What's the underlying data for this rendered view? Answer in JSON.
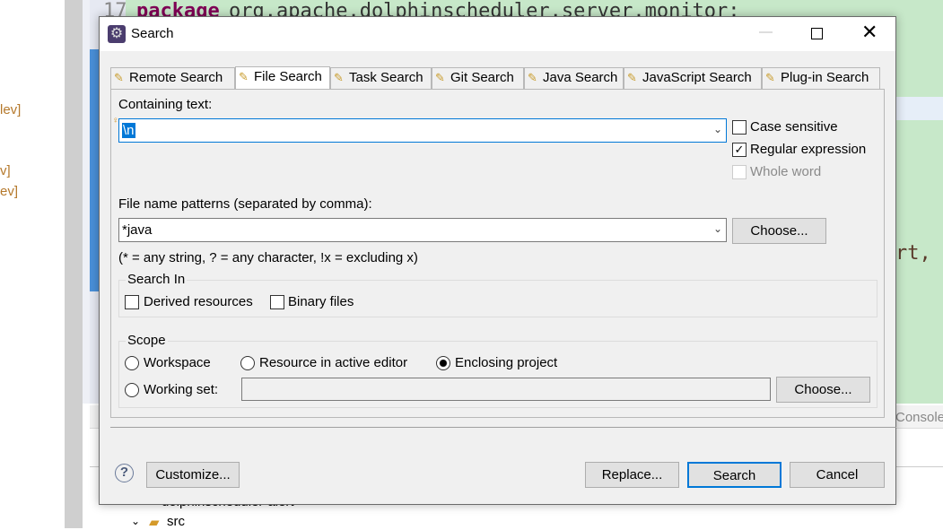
{
  "background": {
    "left_labels": [
      "lev]",
      "v]",
      "ev]"
    ],
    "code_line_number": "17",
    "code_keyword": "package",
    "code_text": " org.apache.dolphinscheduler.server.monitor;",
    "code_fragment": "rt, ",
    "console_tab": "Console",
    "tree_project": "dolphinscheduler-alert",
    "tree_src": "src"
  },
  "dialog": {
    "title": "Search",
    "tabs": [
      {
        "label": "Remote Search",
        "active": false
      },
      {
        "label": "File Search",
        "active": true
      },
      {
        "label": "Task Search",
        "active": false
      },
      {
        "label": "Git Search",
        "active": false
      },
      {
        "label": "Java Search",
        "active": false
      },
      {
        "label": "JavaScript Search",
        "active": false
      },
      {
        "label": "Plug-in Search",
        "active": false
      }
    ],
    "containing_text_label": "Containing text:",
    "containing_text_value": "\\n",
    "case_sensitive": {
      "label": "Case sensitive",
      "checked": false
    },
    "regular_expression": {
      "label": "Regular expression",
      "checked": true
    },
    "whole_word": {
      "label": "Whole word",
      "checked": false,
      "disabled": true
    },
    "file_patterns_label": "File name patterns (separated by comma):",
    "file_patterns_value": "*java",
    "choose_label": "Choose...",
    "patterns_hint": "(* = any string, ? = any character, !x = excluding x)",
    "search_in": {
      "title": "Search In",
      "derived": "Derived resources",
      "binary": "Binary files"
    },
    "scope": {
      "title": "Scope",
      "workspace": "Workspace",
      "active_editor": "Resource in active editor",
      "enclosing": "Enclosing project",
      "working_set": "Working set:",
      "working_set_value": "",
      "selected": "enclosing"
    },
    "buttons": {
      "customize": "Customize...",
      "replace": "Replace...",
      "search": "Search",
      "cancel": "Cancel"
    }
  }
}
